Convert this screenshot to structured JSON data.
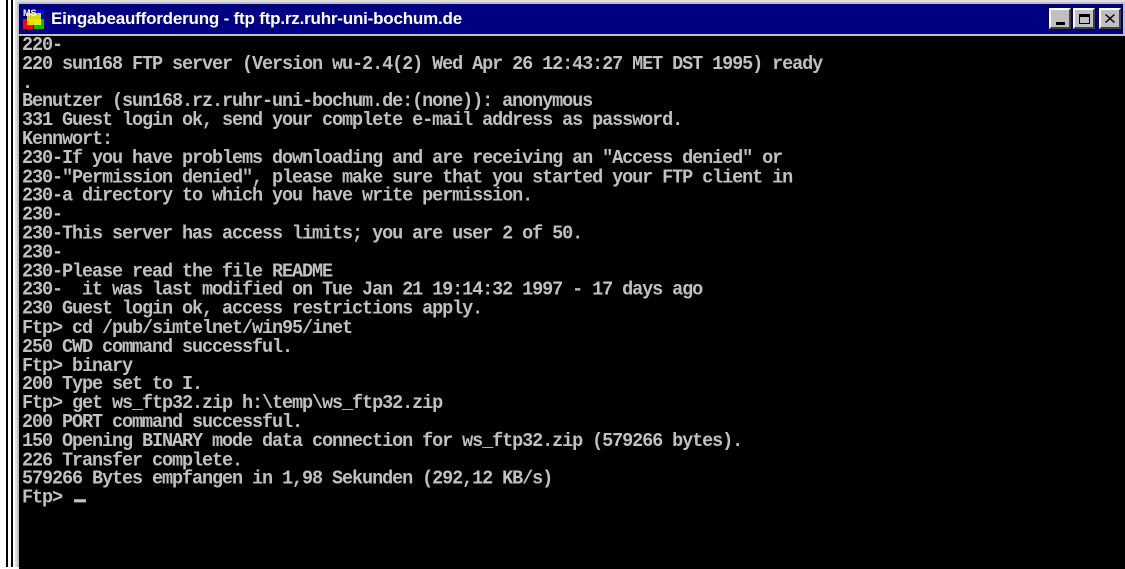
{
  "window": {
    "title": "Eingabeaufforderung - ftp ftp.rz.ruhr-uni-bochum.de",
    "icon": "ms-dos-icon",
    "icon_text": "MS",
    "controls": [
      "minimize",
      "maximize",
      "close"
    ]
  },
  "console": {
    "lines": [
      "220-",
      "220 sun168 FTP server (Version wu-2.4(2) Wed Apr 26 12:43:27 MET DST 1995) ready",
      ".",
      "Benutzer (sun168.rz.ruhr-uni-bochum.de:(none)): anonymous",
      "331 Guest login ok, send your complete e-mail address as password.",
      "Kennwort:",
      "230-If you have problems downloading and are receiving an \"Access denied\" or",
      "230-\"Permission denied\", please make sure that you started your FTP client in",
      "230-a directory to which you have write permission.",
      "230-",
      "230-This server has access limits; you are user 2 of 50.",
      "230-",
      "230-Please read the file README",
      "230-  it was last modified on Tue Jan 21 19:14:32 1997 - 17 days ago",
      "230 Guest login ok, access restrictions apply.",
      "Ftp> cd /pub/simtelnet/win95/inet",
      "250 CWD command successful.",
      "Ftp> binary",
      "200 Type set to I.",
      "Ftp> get ws_ftp32.zip h:\\temp\\ws_ftp32.zip",
      "200 PORT command successful.",
      "150 Opening BINARY mode data connection for ws_ftp32.zip (579266 bytes).",
      "226 Transfer complete.",
      "579266 Bytes empfangen in 1,98 Sekunden (292,12 KB/s)"
    ],
    "prompt": "Ftp> "
  },
  "colors": {
    "titlebar": "#000080",
    "console_bg": "#000000",
    "console_fg": "#c0c0c0"
  }
}
